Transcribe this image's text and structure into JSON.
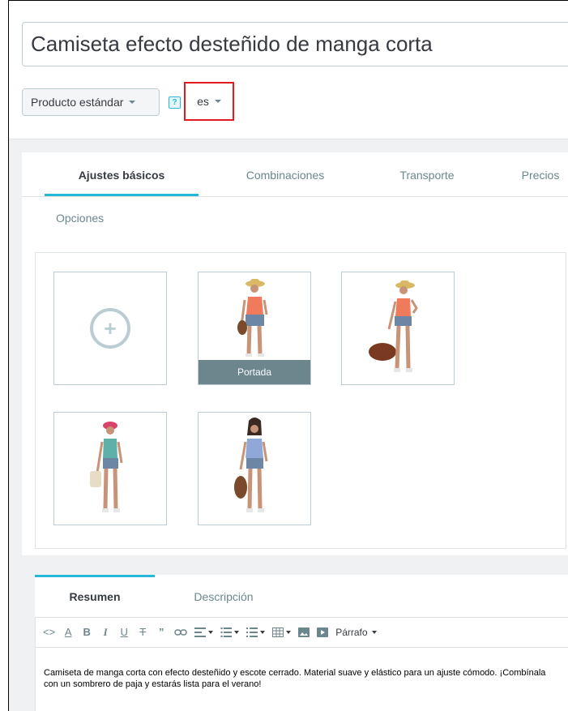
{
  "product": {
    "title": "Camiseta efecto desteñido de manga corta",
    "type_label": "Producto estándar",
    "help_icon": "?",
    "language": "es"
  },
  "tabs": [
    {
      "label": "Ajustes básicos",
      "active": true
    },
    {
      "label": "Combinaciones",
      "active": false
    },
    {
      "label": "Transporte",
      "active": false
    },
    {
      "label": "Precios",
      "active": false
    }
  ],
  "options_label": "Opciones",
  "images": {
    "add_icon": "plus-circle-icon",
    "cover_label": "Portada"
  },
  "editor": {
    "tabs": [
      {
        "label": "Resumen",
        "active": true
      },
      {
        "label": "Descripción",
        "active": false
      }
    ],
    "toolbar": {
      "code": "<>",
      "text_color": "A",
      "bold": "B",
      "italic": "I",
      "underline": "U",
      "strikethrough": "T",
      "quote": "”",
      "paragraph": "Párrafo"
    },
    "content": "Camiseta de manga corta con efecto desteñido y escote cerrado. Material suave y elástico para un ajuste cómodo. ¡Combínala con un sombrero de paja y estarás lista para el verano!"
  },
  "colors": {
    "accent": "#25b9d7",
    "highlight": "#e3191e",
    "cover": "#6c868e"
  }
}
